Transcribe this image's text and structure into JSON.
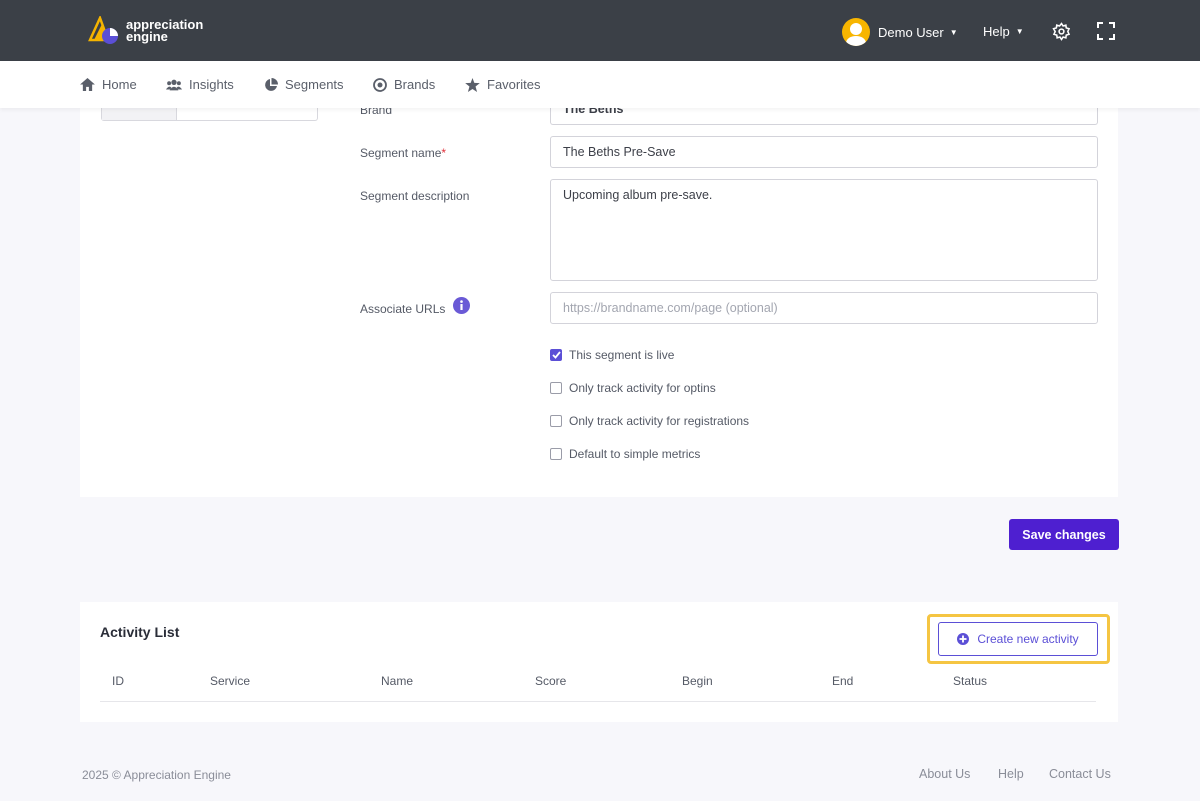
{
  "brand": {
    "name_line1": "appreciation",
    "name_line2": "engine"
  },
  "header": {
    "user_name": "Demo User",
    "help_label": "Help"
  },
  "nav": [
    {
      "label": "Home"
    },
    {
      "label": "Insights"
    },
    {
      "label": "Segments"
    },
    {
      "label": "Brands"
    },
    {
      "label": "Favorites"
    }
  ],
  "form": {
    "brand_label": "Brand",
    "brand_value": "The Beths",
    "segment_name_label": "Segment name",
    "segment_name_required": "*",
    "segment_name_value": "The Beths Pre-Save",
    "segment_description_label": "Segment description",
    "segment_description_value": "Upcoming album pre-save.",
    "associate_urls_label": "Associate URLs",
    "associate_urls_placeholder": "https://brandname.com/page (optional)",
    "checkboxes": [
      {
        "label": "This segment is live",
        "checked": true
      },
      {
        "label": "Only track activity for optins",
        "checked": false
      },
      {
        "label": "Only track activity for registrations",
        "checked": false
      },
      {
        "label": "Default to simple metrics",
        "checked": false
      }
    ],
    "save_label": "Save changes"
  },
  "activity": {
    "title": "Activity List",
    "create_label": "Create new activity",
    "columns": [
      "ID",
      "Service",
      "Name",
      "Score",
      "Begin",
      "End",
      "Status"
    ]
  },
  "footer": {
    "copyright": "2025 © Appreciation Engine",
    "links": [
      "About Us",
      "Help",
      "Contact Us"
    ]
  },
  "colors": {
    "topbar": "#3b4047",
    "accent": "#4e1fd0",
    "highlight": "#f5c542"
  }
}
